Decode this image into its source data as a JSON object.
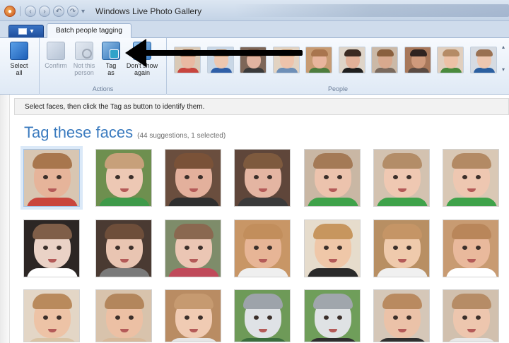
{
  "window": {
    "title": "Windows Live Photo Gallery",
    "qat_icons": [
      "app-icon",
      "back-icon",
      "forward-icon",
      "undo-icon",
      "redo-icon",
      "dropdown-icon"
    ]
  },
  "tabs": {
    "menu_label": "▾",
    "active": "Batch people tagging"
  },
  "ribbon": {
    "select_all": "Select\nall",
    "actions": {
      "confirm": "Confirm",
      "not_this_person": "Not this\nperson",
      "tag_as": "Tag\nas",
      "dont_show_again": "Don't show\nagain",
      "group_label": "Actions"
    },
    "people_label": "People",
    "people": [
      {
        "skin": "#e9b9a2",
        "hair": "#8a5a3b",
        "shirt": "#c8453e",
        "bg": "#d9c9b6"
      },
      {
        "skin": "#edc7b0",
        "hair": "#b08660",
        "shirt": "#2f5fa8",
        "bg": "#c9d7e6"
      },
      {
        "skin": "#e0b3a0",
        "hair": "#6a4a36",
        "shirt": "#3a3a3a",
        "bg": "#7d6658"
      },
      {
        "skin": "#eec3ab",
        "hair": "#c79c72",
        "shirt": "#6e8fb7",
        "bg": "#e2d3c2"
      },
      {
        "skin": "#e8b59d",
        "hair": "#a9754e",
        "shirt": "#4e7d3e",
        "bg": "#c79b73"
      },
      {
        "skin": "#e2b199",
        "hair": "#3b2a22",
        "shirt": "#1f1f1f",
        "bg": "#ded4c8"
      },
      {
        "skin": "#d8a98e",
        "hair": "#8a603e",
        "shirt": "#7a6a5e",
        "bg": "#cbb9a7"
      },
      {
        "skin": "#cf9a7c",
        "hair": "#2f2320",
        "shirt": "#5b4b43",
        "bg": "#a8785b"
      },
      {
        "skin": "#ecc1a6",
        "hair": "#b58b66",
        "shirt": "#4a8a3d",
        "bg": "#e0cfbf"
      },
      {
        "skin": "#eec7b0",
        "hair": "#9a7152",
        "shirt": "#2b5fa0",
        "bg": "#d6dbe2"
      }
    ]
  },
  "info_text": "Select faces, then click the Tag as button to identify them.",
  "heading": {
    "title": "Tag these faces",
    "subtitle": "(44 suggestions, 1 selected)"
  },
  "faces": [
    {
      "skin": "#e6b49a",
      "hair": "#a8764d",
      "shirt": "#c9463d",
      "bg": "#d8c6b2",
      "selected": true
    },
    {
      "skin": "#edc8b4",
      "hair": "#c7a07a",
      "shirt": "#3f9a4a",
      "bg": "#6e8f4f",
      "selected": false
    },
    {
      "skin": "#e3b09c",
      "hair": "#7a5238",
      "shirt": "#2f2f2f",
      "bg": "#6a4e3e",
      "selected": false
    },
    {
      "skin": "#e4b5a2",
      "hair": "#7e5a3e",
      "shirt": "#3a3a3a",
      "bg": "#5f463a",
      "selected": false
    },
    {
      "skin": "#ecc3ad",
      "hair": "#a47a56",
      "shirt": "#3fa24a",
      "bg": "#c9b7a4",
      "selected": false
    },
    {
      "skin": "#efc8b2",
      "hair": "#b38d68",
      "shirt": "#3fa24a",
      "bg": "#d3c2b0",
      "selected": false
    },
    {
      "skin": "#eec7b1",
      "hair": "#b38a64",
      "shirt": "#3fa24a",
      "bg": "#d9c8b5",
      "selected": false
    },
    {
      "skin": "#ead2c6",
      "hair": "#7f5e48",
      "shirt": "#ffffff",
      "bg": "#2c2624",
      "selected": false
    },
    {
      "skin": "#e9c5b2",
      "hair": "#6e4e3a",
      "shirt": "#7a7a7a",
      "bg": "#4a3a32",
      "selected": false
    },
    {
      "skin": "#ebc6b4",
      "hair": "#8a6850",
      "shirt": "#c04a5a",
      "bg": "#7e8c6a",
      "selected": false
    },
    {
      "skin": "#e7b596",
      "hair": "#c28e5c",
      "shirt": "#efefef",
      "bg": "#c89666",
      "selected": false
    },
    {
      "skin": "#efc7a8",
      "hair": "#c7965e",
      "shirt": "#2a2a2a",
      "bg": "#e6dccc",
      "selected": false
    },
    {
      "skin": "#efcaac",
      "hair": "#c59566",
      "shirt": "#f0f0f0",
      "bg": "#b88f63",
      "selected": false
    },
    {
      "skin": "#e9b99c",
      "hair": "#b9865a",
      "shirt": "#ffffff",
      "bg": "#c89b72",
      "selected": false
    },
    {
      "skin": "#edc3a6",
      "hair": "#b98a5c",
      "shirt": "#d9c4a5",
      "bg": "#e3d6c6",
      "selected": false
    },
    {
      "skin": "#ecc0a4",
      "hair": "#b3865c",
      "shirt": "#d7b99a",
      "bg": "#d8c3ac",
      "selected": false
    },
    {
      "skin": "#f0cbb3",
      "hair": "#c69a70",
      "shirt": "#e6e6e6",
      "bg": "#b98c63",
      "selected": false
    },
    {
      "skin": "#dfe2e6",
      "hair": "#9da3aa",
      "shirt": "#3a6d3c",
      "bg": "#6e9a58",
      "selected": false
    },
    {
      "skin": "#dfe2e4",
      "hair": "#a0a6ac",
      "shirt": "#2d2d2d",
      "bg": "#6f9e5a",
      "selected": false
    },
    {
      "skin": "#ebc2a8",
      "hair": "#b98a60",
      "shirt": "#2f2f2f",
      "bg": "#d5c7b8",
      "selected": false
    },
    {
      "skin": "#edc6ae",
      "hair": "#b68c66",
      "shirt": "#e8e8e8",
      "bg": "#d1c0ae",
      "selected": false
    }
  ]
}
